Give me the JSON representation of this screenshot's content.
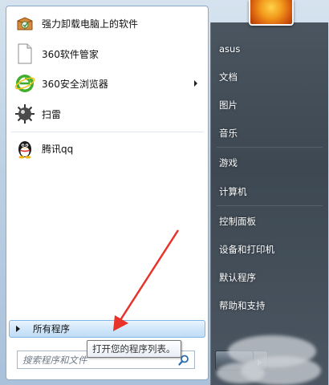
{
  "programs": [
    {
      "label": "强力卸载电脑上的软件",
      "icon": "uninstall-box-icon",
      "has_submenu": false
    },
    {
      "label": "360软件管家",
      "icon": "blank-document-icon",
      "has_submenu": false
    },
    {
      "label": "360安全浏览器",
      "icon": "360-browser-icon",
      "has_submenu": true
    },
    {
      "label": "扫雷",
      "icon": "minesweeper-mine-icon",
      "has_submenu": false
    },
    {
      "label": "腾讯qq",
      "icon": "qq-penguin-icon",
      "has_submenu": false
    }
  ],
  "all_programs": {
    "label": "所有程序"
  },
  "tooltip": {
    "text": "打开您的程序列表。"
  },
  "search": {
    "placeholder": "搜索程序和文件",
    "value": ""
  },
  "right_menu": [
    {
      "label": "asus"
    },
    {
      "label": "文档"
    },
    {
      "label": "图片"
    },
    {
      "label": "音乐"
    },
    {
      "label": "游戏"
    },
    {
      "label": "计算机"
    },
    {
      "label": "控制面板"
    },
    {
      "label": "设备和打印机"
    },
    {
      "label": "默认程序"
    },
    {
      "label": "帮助和支持"
    }
  ],
  "colors": {
    "highlight": "#c0ddf6",
    "right_panel": "#3d4852",
    "annotation_arrow": "#e8332a"
  }
}
